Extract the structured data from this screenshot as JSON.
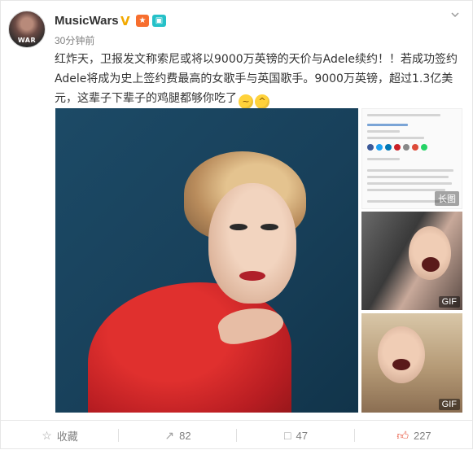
{
  "post": {
    "username": "MusicWars",
    "verified_mark": "V",
    "badge_vip_icon": "vip-icon",
    "badge_camera_icon": "camera-icon",
    "time": "30分钟前",
    "avatar_caption": "WAR",
    "text": "红炸天，卫报发文称索尼或将以9000万英镑的天价与Adele续约！！若成功签约Adele将成为史上签约费最高的女歌手与英国歌手。9000万英镑，超过1.3亿美元，这辈子下辈子的鸡腿都够你吃了",
    "emojis": [
      "drooling-emoji",
      "smirk-cat-emoji"
    ]
  },
  "media": {
    "thumbs": [
      {
        "tag": "长图"
      },
      {
        "tag": "GIF"
      },
      {
        "tag": "GIF"
      }
    ]
  },
  "actions": {
    "favorite": {
      "label": "收藏",
      "icon": "star-icon"
    },
    "share": {
      "count": "82",
      "icon": "share-icon"
    },
    "comment": {
      "count": "47",
      "icon": "comment-icon"
    },
    "like": {
      "count": "227",
      "icon": "thumbs-up-icon",
      "color": "#e8543c"
    }
  },
  "colors": {
    "accent": "#f2a900",
    "link": "#eb7350"
  }
}
